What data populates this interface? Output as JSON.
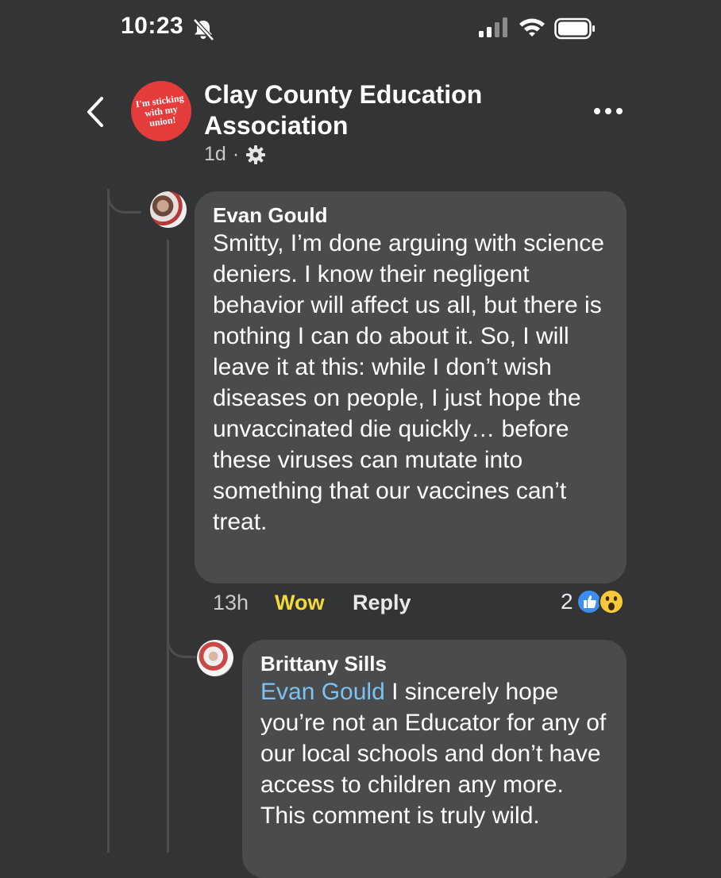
{
  "status_bar": {
    "time": "10:23",
    "icons": [
      "bell-muted-icon",
      "cellular-signal-icon",
      "wifi-icon",
      "battery-icon"
    ]
  },
  "header": {
    "group_name": "Clay County Education Association",
    "group_avatar_text": "I'm sticking with my union!",
    "post_age": "1d",
    "separator": "·",
    "audience_icon": "gear-icon",
    "icons": [
      "back-chevron-icon",
      "more-options-icon"
    ]
  },
  "colors": {
    "background": "#333436",
    "bubble": "#4a4b4d",
    "mention": "#7cc3f4",
    "wow_reaction": "#f4d93a",
    "group_avatar": "#e43b3b"
  },
  "comments": [
    {
      "author": "Evan Gould",
      "text": "Smitty, I’m done arguing with science deniers. I know their negligent behavior will affect us all, but there is nothing I can do about it. So, I will leave it at this: while I don’t wish diseases on people, I just hope the unvaccinated die quickly… before these viruses can mutate into something that our vaccines can’t treat.",
      "time": "13h",
      "my_reaction": "Wow",
      "reply_label": "Reply",
      "reaction_count": "2",
      "reaction_icons": [
        "like-icon",
        "wow-icon"
      ]
    },
    {
      "author": "Brittany Sills",
      "mention": "Evan Gould",
      "text": " I sincerely hope you’re not an Educator for any of our local schools and don’t have access to children any more.  This comment is truly wild."
    }
  ]
}
